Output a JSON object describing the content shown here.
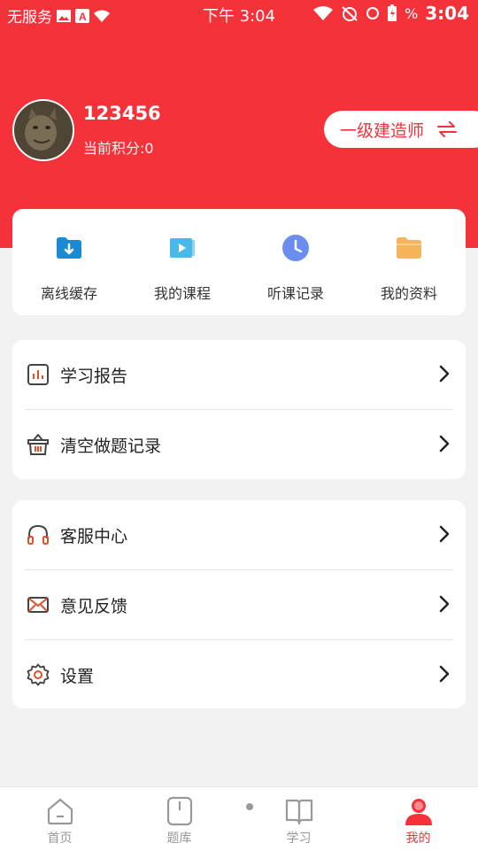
{
  "status_bar": {
    "left_text": "无服务",
    "time_center": "下午 3:04",
    "time_right": "3:04",
    "battery_text": "%"
  },
  "profile": {
    "username": "123456",
    "points_label": "当前积分:",
    "points_value": "0",
    "exam_type": "一级建造师"
  },
  "quick_actions": [
    {
      "label": "离线缓存",
      "icon": "download-folder-icon",
      "color": "#1a8ad4"
    },
    {
      "label": "我的课程",
      "icon": "video-course-icon",
      "color": "#4ab8e8"
    },
    {
      "label": "听课记录",
      "icon": "clock-icon",
      "color": "#6b8cf0"
    },
    {
      "label": "我的资料",
      "icon": "folder-icon",
      "color": "#f7b35a"
    }
  ],
  "menu_group_1": [
    {
      "label": "学习报告",
      "icon": "report-chart-icon"
    },
    {
      "label": "清空做题记录",
      "icon": "trash-basket-icon"
    }
  ],
  "menu_group_2": [
    {
      "label": "客服中心",
      "icon": "headphones-icon"
    },
    {
      "label": "意见反馈",
      "icon": "envelope-icon"
    },
    {
      "label": "设置",
      "icon": "gear-icon"
    }
  ],
  "tabs": [
    {
      "label": "首页",
      "icon": "home-icon",
      "active": false
    },
    {
      "label": "题库",
      "icon": "question-bank-icon",
      "active": false
    },
    {
      "label": "学习",
      "icon": "book-icon",
      "active": false
    },
    {
      "label": "我的",
      "icon": "user-icon",
      "active": true
    }
  ],
  "colors": {
    "brand_red": "#f5313a",
    "background": "#f2f2f2",
    "icon_accent": "#e0502a"
  }
}
